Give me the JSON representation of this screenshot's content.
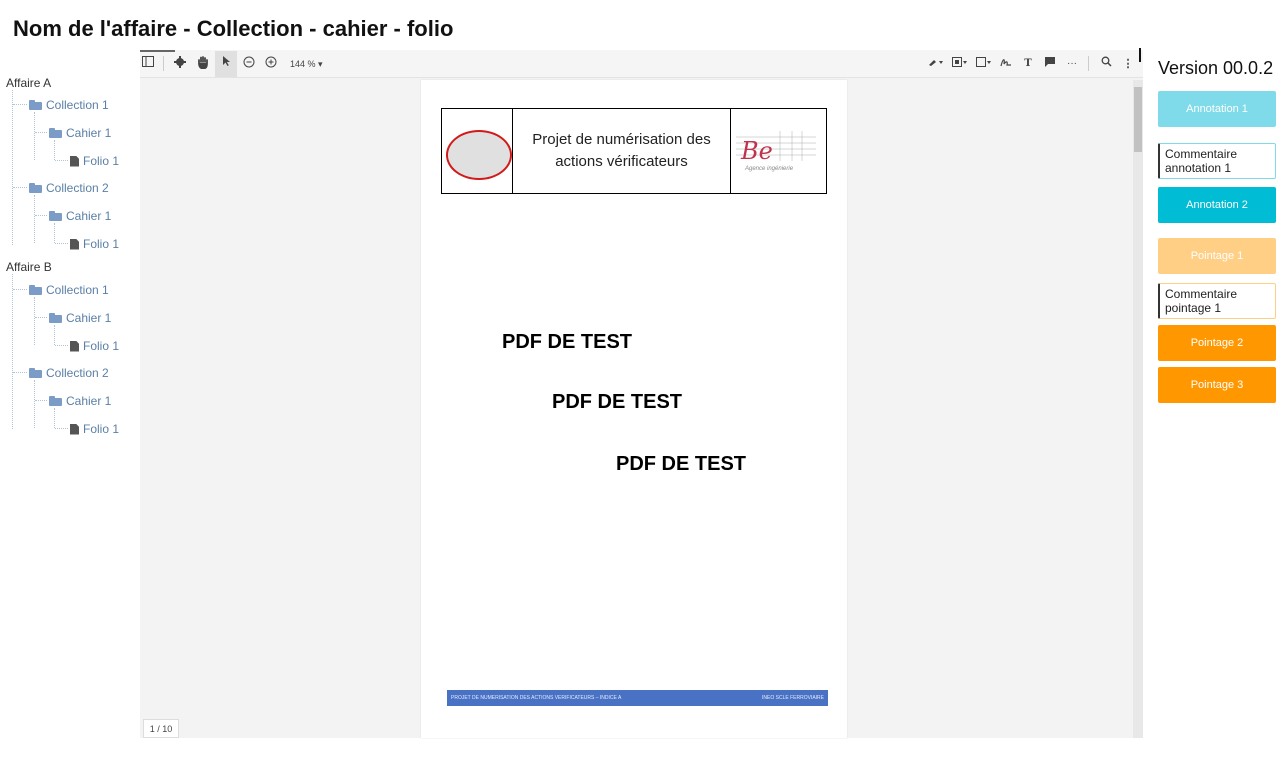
{
  "title": "Nom de l'affaire - Collection - cahier - folio",
  "tree": {
    "affaires": [
      {
        "label": "Affaire A",
        "collections": [
          {
            "label": "Collection 1",
            "cahier": "Cahier 1",
            "folio": "Folio 1"
          },
          {
            "label": "Collection 2",
            "cahier": "Cahier 1",
            "folio": "Folio 1"
          }
        ]
      },
      {
        "label": "Affaire B",
        "collections": [
          {
            "label": "Collection 1",
            "cahier": "Cahier 1",
            "folio": "Folio 1"
          },
          {
            "label": "Collection 2",
            "cahier": "Cahier 1",
            "folio": "Folio 1"
          }
        ]
      }
    ]
  },
  "toolbar": {
    "zoom": "144 %"
  },
  "pdf": {
    "header_text": "Projet de numérisation des actions vérificateurs",
    "logo_text": "Be",
    "logo_sub": "Agence ingénierie",
    "body_lines": [
      "PDF DE TEST",
      "PDF DE TEST",
      "PDF DE TEST"
    ],
    "footer_left": "PROJET DE NUMERISATION DES ACTIONS VERIFICATEURS – INDICE A",
    "footer_right": "INEO SCLE FERROVIAIRE",
    "page_indicator": "1 / 10"
  },
  "side": {
    "version": "Version 00.0.2",
    "annotation_1": "Annotation 1",
    "comment_annotation": "Commentaire annotation 1",
    "annotation_2": "Annotation 2",
    "pointage_1": "Pointage 1",
    "comment_pointage": "Commentaire pointage 1",
    "pointage_2": "Pointage 2",
    "pointage_3": "Pointage 3"
  },
  "colors": {
    "annotation_light": "#7fdbe9",
    "annotation": "#00bcd4",
    "pointage_light": "#ffcf86",
    "pointage": "#ff9800",
    "footer_blue": "#4a72c4"
  }
}
